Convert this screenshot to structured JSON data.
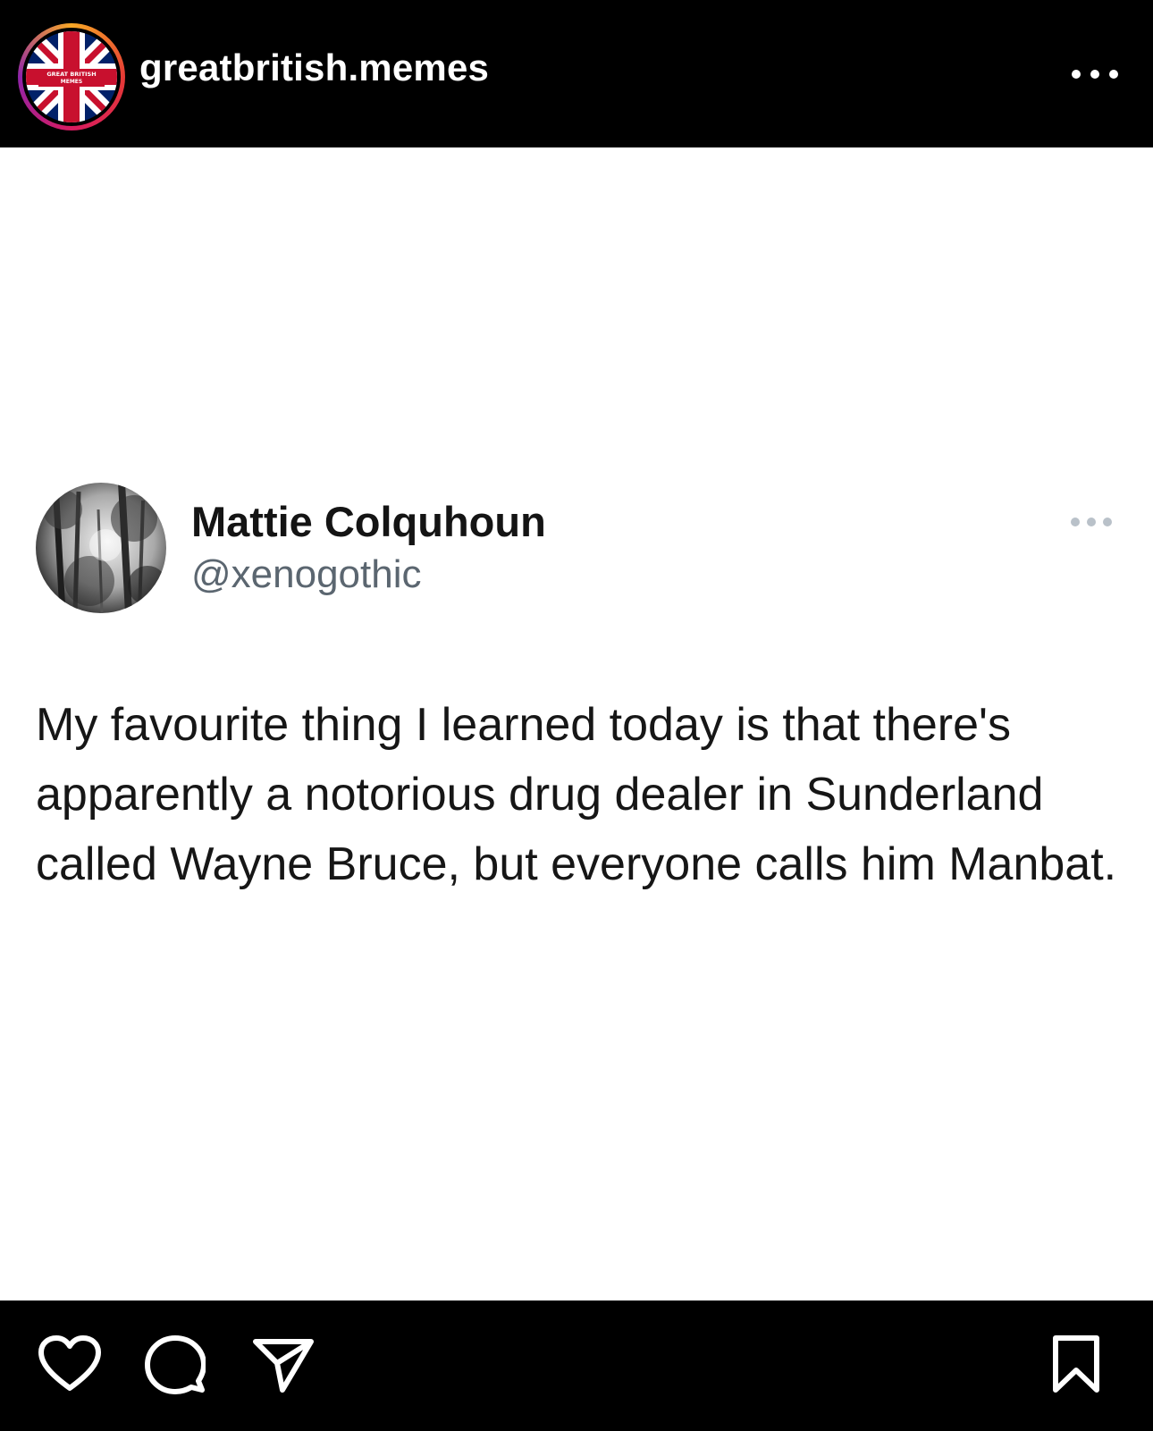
{
  "header": {
    "username": "greatbritish.memes",
    "avatar_text_line1": "GREAT BRITISH",
    "avatar_text_line2": "MEMES",
    "avatar_icon": "union-jack-logo",
    "more_icon": "more-horizontal-icon"
  },
  "tweet": {
    "display_name": "Mattie Colquhoun",
    "handle": "@xenogothic",
    "text": "My favourite thing I learned today is that there's apparently a notorious drug dealer in Sunderland called Wayne Bruce, but everyone calls him Manbat.",
    "avatar_icon": "forest-photo-avatar",
    "more_icon": "more-horizontal-icon"
  },
  "actions": {
    "like_icon": "heart-icon",
    "comment_icon": "comment-icon",
    "share_icon": "send-icon",
    "save_icon": "bookmark-icon"
  },
  "colors": {
    "background": "#000000",
    "post_background": "#ffffff",
    "tweet_text": "#161616",
    "tweet_handle": "#5b6670",
    "flag_red": "#c8102e",
    "flag_blue": "#012169"
  }
}
